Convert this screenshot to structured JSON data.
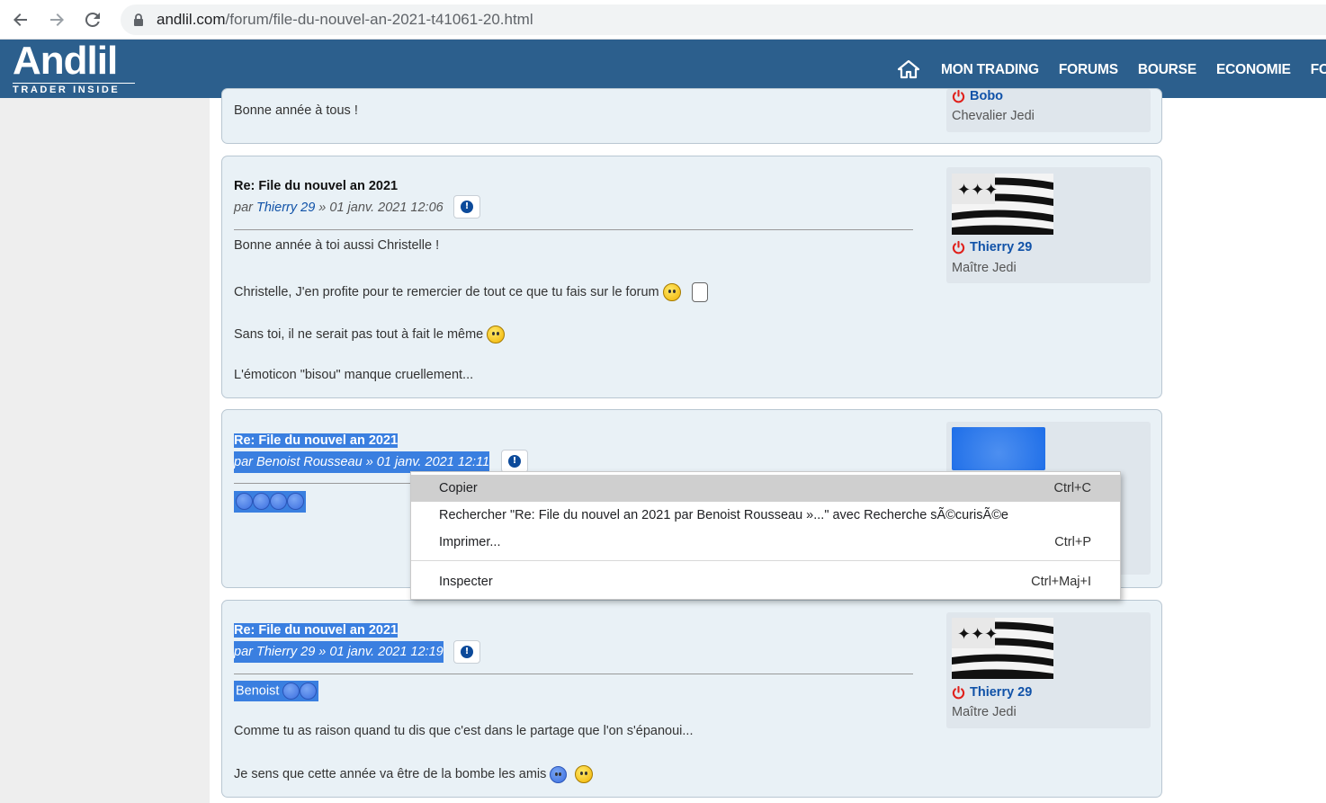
{
  "browser": {
    "url_host": "andlil.com",
    "url_path": "/forum/file-du-nouvel-an-2021-t41061-20.html"
  },
  "site": {
    "logo_text": "Andlil",
    "logo_tagline": "TRADER INSIDE",
    "menu": [
      "MON TRADING",
      "FORUMS",
      "BOURSE",
      "ECONOMIE",
      "FO"
    ]
  },
  "posts": [
    {
      "body": [
        "Bonne année à tous !"
      ],
      "user_name": "Bobo",
      "rank": "Chevalier Jedi"
    },
    {
      "title": "Re: File du nouvel an 2021",
      "meta_prefix": "par ",
      "author": "Thierry 29",
      "meta_date": " » 01 janv. 2021 12:06",
      "body": [
        "Bonne année à toi aussi Christelle !",
        "Christelle, J'en profite pour te remercier de tout ce que tu fais sur le forum",
        "Sans toi, il ne serait pas tout à fait le même",
        "L'émoticon \"bisou\" manque cruellement..."
      ],
      "user_name": "Thierry 29",
      "rank": "Maître Jedi"
    },
    {
      "title": "Re: File du nouvel an 2021",
      "meta_prefix": "par ",
      "author": "Benoist Rousseau",
      "meta_date": " » 01 janv. 2021 12:11"
    },
    {
      "title": "Re: File du nouvel an 2021",
      "meta_prefix": "par ",
      "author": "Thierry 29",
      "meta_date": " » 01 janv. 2021 12:19",
      "body": [
        "Benoist",
        "Comme tu as raison quand tu dis que c'est dans le partage que l'on s'épanoui...",
        "Je sens que cette année va être de la bombe les amis"
      ],
      "user_name": "Thierry 29",
      "rank": "Maître Jedi"
    }
  ],
  "context_menu": {
    "items": [
      {
        "label": "Copier",
        "shortcut": "Ctrl+C"
      },
      {
        "label": "Rechercher \"Re: File du nouvel an 2021 par Benoist Rousseau »...\" avec Recherche sÃ©curisÃ©e",
        "shortcut": ""
      },
      {
        "label": "Imprimer...",
        "shortcut": "Ctrl+P"
      },
      {
        "label": "Inspecter",
        "shortcut": "Ctrl+Maj+I"
      }
    ]
  },
  "colors": {
    "header_bg": "#2c5f8d",
    "post_bg": "#e9f1f6",
    "link": "#1052a8",
    "selection": "#3a7fe0"
  }
}
